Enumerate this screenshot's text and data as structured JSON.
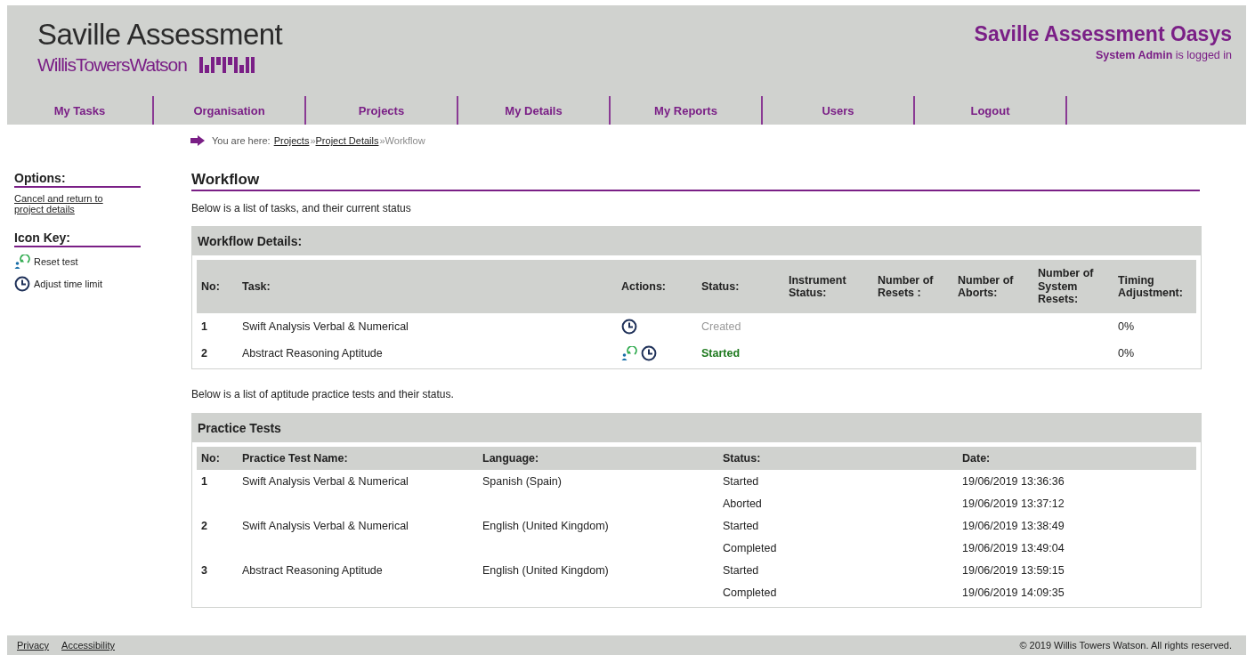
{
  "header": {
    "brand": "Saville Assessment",
    "sub_brand": "WillisTowersWatson",
    "app_title": "Saville Assessment Oasys",
    "user": "System Admin",
    "user_suffix": "is logged in"
  },
  "nav": [
    "My Tasks",
    "Organisation",
    "Projects",
    "My Details",
    "My Reports",
    "Users",
    "Logout"
  ],
  "breadcrumb": {
    "label": "You are here:",
    "links": [
      "Projects",
      "Project Details"
    ],
    "current": "Workflow",
    "separator": "»"
  },
  "sidebar": {
    "options_title": "Options:",
    "options": [
      "Cancel and return to project details"
    ],
    "icon_key_title": "Icon Key:",
    "icon_key": [
      {
        "kind": "reset",
        "label": "Reset test"
      },
      {
        "kind": "clock",
        "label": "Adjust time limit"
      }
    ]
  },
  "page_title": "Workflow",
  "intro": "Below is a list of tasks, and their current status",
  "workflow": {
    "title": "Workflow Details:",
    "columns": [
      "No:",
      "Task:",
      "Actions:",
      "Status:",
      "Instrument Status:",
      "Number of Resets :",
      "Number of Aborts:",
      "Number of System Resets:",
      "Timing Adjustment:"
    ],
    "rows": [
      {
        "no": "1",
        "task": "Swift Analysis Verbal & Numerical",
        "actions": [
          {
            "kind": "clock"
          }
        ],
        "status": {
          "label": "Created",
          "kind": "created"
        },
        "timing": "0%"
      },
      {
        "no": "2",
        "task": "Abstract Reasoning Aptitude",
        "actions": [
          {
            "kind": "reset"
          },
          {
            "kind": "clock"
          }
        ],
        "status": {
          "label": "Started",
          "kind": "started"
        },
        "timing": "0%"
      }
    ]
  },
  "practice_intro": "Below is a list of aptitude practice tests and their status.",
  "practice": {
    "title": "Practice Tests",
    "columns": [
      "No:",
      "Practice Test Name:",
      "Language:",
      "Status:",
      "Date:"
    ],
    "rows": [
      {
        "no": "1",
        "name": "Swift Analysis Verbal & Numerical",
        "language": "Spanish (Spain)",
        "events": [
          {
            "status": "Started",
            "date": "19/06/2019 13:36:36"
          },
          {
            "status": "Aborted",
            "date": "19/06/2019 13:37:12"
          }
        ]
      },
      {
        "no": "2",
        "name": "Swift Analysis Verbal & Numerical",
        "language": "English (United Kingdom)",
        "events": [
          {
            "status": "Started",
            "date": "19/06/2019 13:38:49"
          },
          {
            "status": "Completed",
            "date": "19/06/2019 13:49:04"
          }
        ]
      },
      {
        "no": "3",
        "name": "Abstract Reasoning Aptitude",
        "language": "English (United Kingdom)",
        "events": [
          {
            "status": "Started",
            "date": "19/06/2019 13:59:15"
          },
          {
            "status": "Completed",
            "date": "19/06/2019 14:09:35"
          }
        ]
      }
    ]
  },
  "footer": {
    "links": [
      "Privacy",
      "Accessibility"
    ],
    "copyright": "© 2019 Willis Towers Watson. All rights reserved."
  }
}
